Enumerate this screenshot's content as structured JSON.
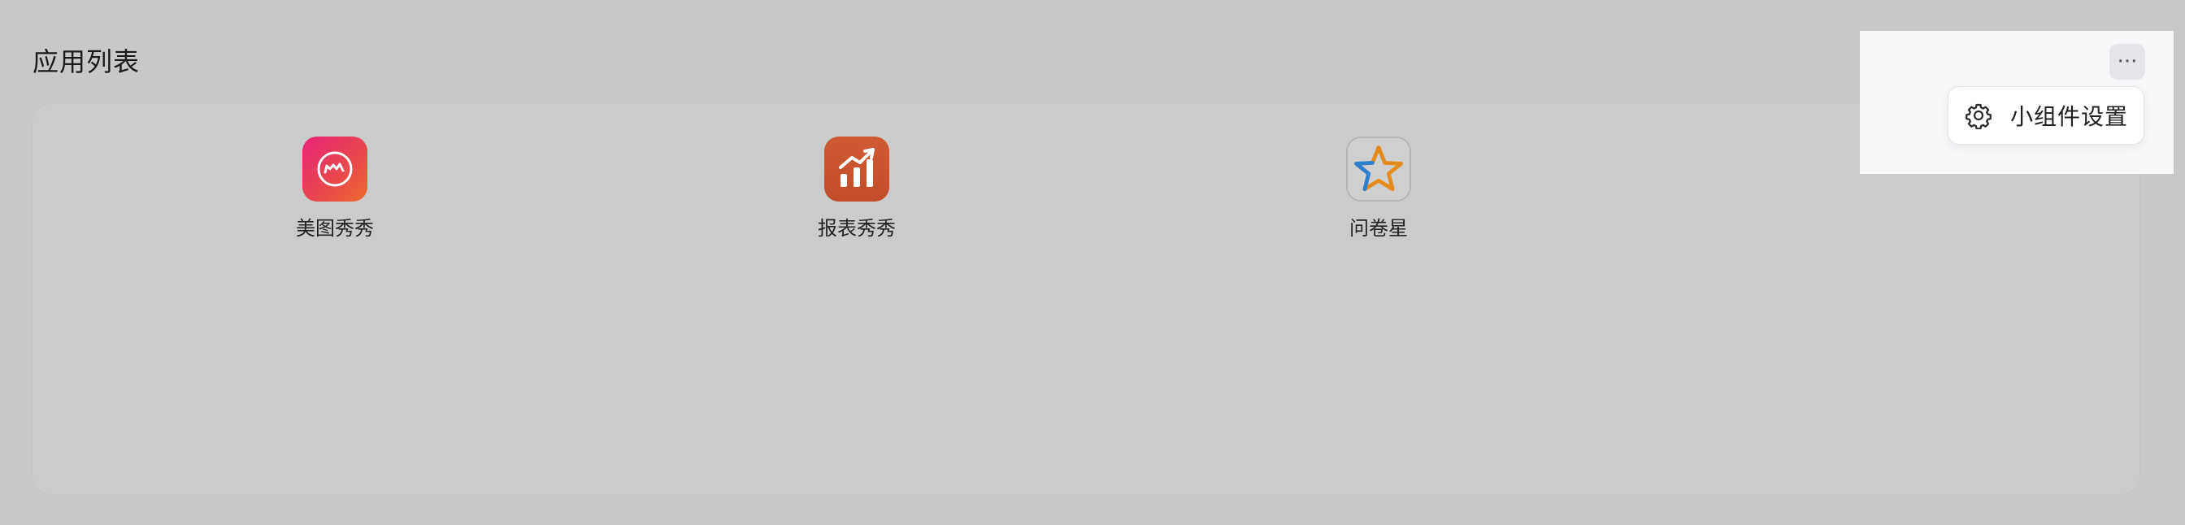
{
  "widget": {
    "title": "应用列表",
    "more_button": "···"
  },
  "apps": [
    {
      "label": "美图秀秀",
      "icon": "meitu-icon"
    },
    {
      "label": "报表秀秀",
      "icon": "report-chart-icon"
    },
    {
      "label": "问卷星",
      "icon": "star-icon"
    }
  ],
  "menu": {
    "items": [
      {
        "label": "小组件设置",
        "icon": "gear-icon"
      }
    ]
  },
  "colors": {
    "background": "#c8c8c8",
    "card": "#cbcbcb",
    "panel": "#f6f7f9",
    "meitu": "#e8237a",
    "report": "#c8522d",
    "star_orange": "#e38b1c",
    "star_blue": "#2d7fd0"
  }
}
